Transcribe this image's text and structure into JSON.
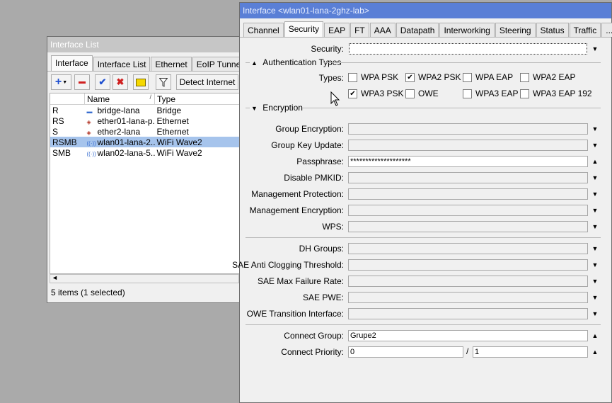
{
  "interface_list": {
    "title": "Interface List",
    "tabs": [
      "Interface",
      "Interface List",
      "Ethernet",
      "EoIP Tunnel"
    ],
    "detect_button": "Detect Internet",
    "columns": [
      "",
      "Name",
      "Type"
    ],
    "rows": [
      {
        "flags": "R",
        "name": "bridge-lana",
        "type": "Bridge",
        "icon": "bridge-icon"
      },
      {
        "flags": "RS",
        "name": "ether01-lana-p...",
        "type": "Ethernet",
        "icon": "ethernet-icon"
      },
      {
        "flags": "S",
        "name": "ether2-lana",
        "type": "Ethernet",
        "icon": "ethernet-icon"
      },
      {
        "flags": "RSMB",
        "name": "wlan01-lana-2...",
        "type": "WiFi Wave2",
        "icon": "wifi-icon",
        "selected": true
      },
      {
        "flags": "SMB",
        "name": "wlan02-lana-5...",
        "type": "WiFi Wave2",
        "icon": "wifi-icon"
      }
    ],
    "status": "5 items (1 selected)"
  },
  "interface_dialog": {
    "title": "Interface <wlan01-lana-2ghz-lab>",
    "tabs": [
      "Channel",
      "Security",
      "EAP",
      "FT",
      "AAA",
      "Datapath",
      "Interworking",
      "Steering",
      "Status",
      "Traffic",
      "..."
    ],
    "active_tab": "Security",
    "security_label": "Security:",
    "auth_section": "Authentication Types",
    "types_label": "Types:",
    "auth_types": [
      {
        "label": "WPA PSK",
        "checked": false
      },
      {
        "label": "WPA2 PSK",
        "checked": true
      },
      {
        "label": "WPA EAP",
        "checked": false
      },
      {
        "label": "WPA2 EAP",
        "checked": false
      },
      {
        "label": "WPA3 PSK",
        "checked": true
      },
      {
        "label": "OWE",
        "checked": false
      },
      {
        "label": "WPA3 EAP",
        "checked": false
      },
      {
        "label": "WPA3 EAP 192",
        "checked": false
      }
    ],
    "encryption_section": "Encryption",
    "fields": {
      "group_encryption": {
        "label": "Group Encryption:",
        "value": ""
      },
      "group_key_update": {
        "label": "Group Key Update:",
        "value": ""
      },
      "passphrase": {
        "label": "Passphrase:",
        "value": "********************"
      },
      "disable_pmkid": {
        "label": "Disable PMKID:",
        "value": ""
      },
      "management_protection": {
        "label": "Management Protection:",
        "value": ""
      },
      "management_encryption": {
        "label": "Management Encryption:",
        "value": ""
      },
      "wps": {
        "label": "WPS:",
        "value": ""
      },
      "dh_groups": {
        "label": "DH Groups:",
        "value": ""
      },
      "sae_anti_clogging": {
        "label": "SAE Anti Clogging Threshold:",
        "value": ""
      },
      "sae_max_failure": {
        "label": "SAE Max Failure Rate:",
        "value": ""
      },
      "sae_pwe": {
        "label": "SAE PWE:",
        "value": ""
      },
      "owe_transition": {
        "label": "OWE Transition Interface:",
        "value": ""
      },
      "connect_group": {
        "label": "Connect Group:",
        "value": "Grupe2"
      },
      "connect_priority": {
        "label": "Connect Priority:",
        "value": "0",
        "separator": "/",
        "value2": "1"
      }
    }
  },
  "colors": {
    "title_active": "#5a7fd6",
    "selection": "#a6c4ec",
    "desktop": "#aaaaaa"
  }
}
